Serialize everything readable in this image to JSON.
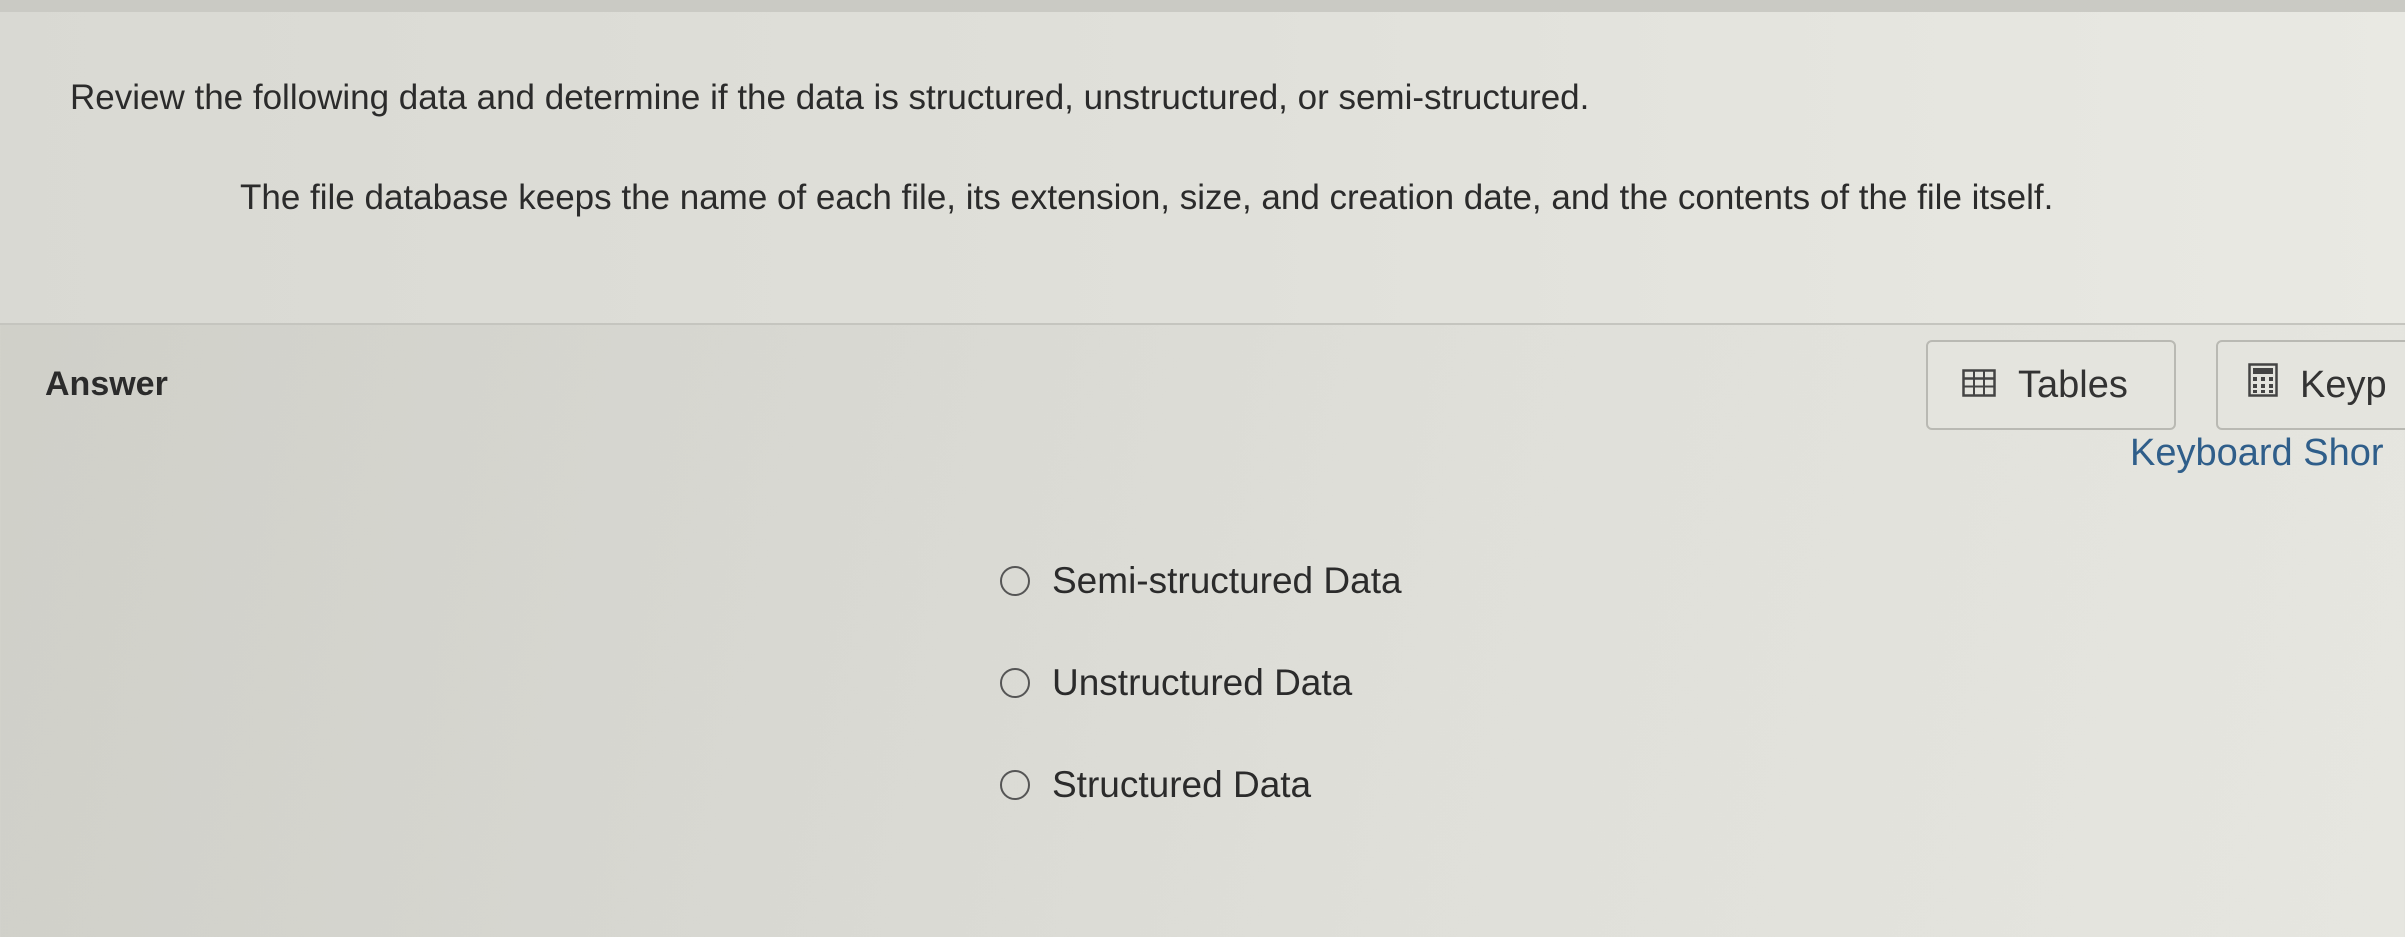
{
  "question": {
    "prompt": "Review the following data and determine if the data is structured, unstructured, or semi-structured.",
    "scenario": "The file database keeps the name of each file, its extension, size, and creation date, and the contents of the file itself."
  },
  "answer": {
    "label": "Answer",
    "toolbar": {
      "tables_label": "Tables",
      "tables_icon": "table-icon",
      "keypad_label": "Keyp",
      "keypad_icon": "calculator-icon",
      "shortcuts_label": "Keyboard Shor"
    },
    "options": [
      {
        "label": "Semi-structured Data",
        "selected": false
      },
      {
        "label": "Unstructured Data",
        "selected": false
      },
      {
        "label": "Structured Data",
        "selected": false
      }
    ]
  }
}
